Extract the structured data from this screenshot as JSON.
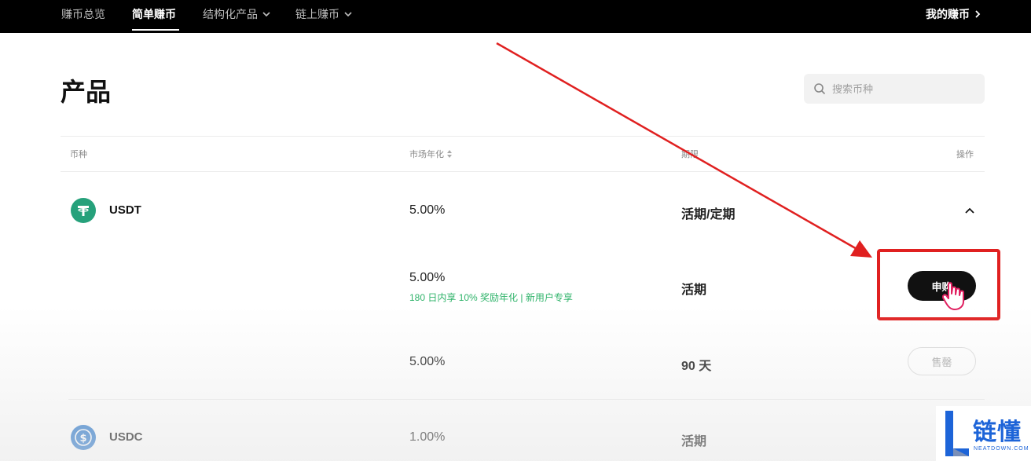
{
  "nav": {
    "items": [
      {
        "label": "赚币总览",
        "dropdown": false,
        "active": false
      },
      {
        "label": "简单赚币",
        "dropdown": false,
        "active": true
      },
      {
        "label": "结构化产品",
        "dropdown": true,
        "active": false
      },
      {
        "label": "链上赚币",
        "dropdown": true,
        "active": false
      }
    ],
    "my_earn": "我的赚币",
    "my_earn_icon": "chevron-right-icon"
  },
  "page": {
    "title": "产品",
    "search_placeholder": "搜索币种"
  },
  "table": {
    "headers": {
      "coin": "币种",
      "apr": "市场年化",
      "term": "期限",
      "action": "操作"
    },
    "rows": [
      {
        "coin": "USDT",
        "apr": "5.00%",
        "term": "活期/定期",
        "expanded": true,
        "sub_rows": [
          {
            "apr": "5.00%",
            "promo": "180 日内享 10% 奖励年化 | 新用户专享",
            "term": "活期",
            "action": "申购"
          },
          {
            "apr": "5.00%",
            "term": "90 天",
            "action": "售罄"
          }
        ]
      },
      {
        "coin": "USDC",
        "apr": "1.00%",
        "term": "活期"
      }
    ]
  },
  "watermark": {
    "text": "链懂",
    "sub": "NEATDOWN.COM"
  },
  "colors": {
    "annotation_red": "#e02020",
    "promo_green": "#2fb36a",
    "usdt_green": "#26a17b",
    "usdc_blue": "#2775ca"
  }
}
